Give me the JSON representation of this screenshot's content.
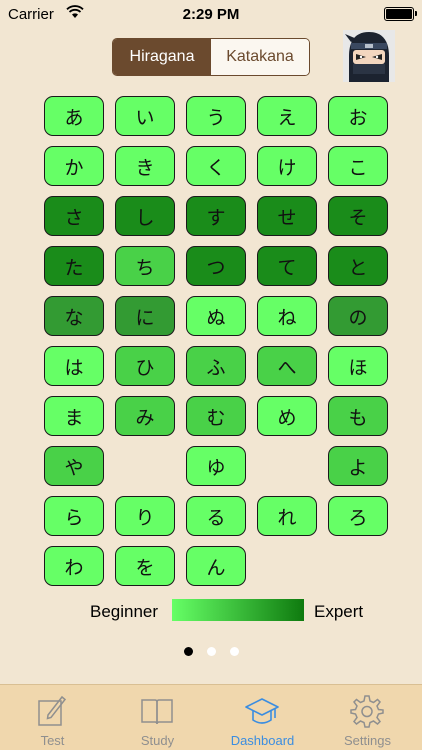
{
  "status_bar": {
    "carrier": "Carrier",
    "time": "2:29 PM"
  },
  "segmented": {
    "options": [
      "Hiragana",
      "Katakana"
    ],
    "selected": "Hiragana"
  },
  "kana_grid": [
    [
      {
        "char": "あ",
        "level": 1
      },
      {
        "char": "い",
        "level": 1
      },
      {
        "char": "う",
        "level": 1
      },
      {
        "char": "え",
        "level": 1
      },
      {
        "char": "お",
        "level": 1
      }
    ],
    [
      {
        "char": "か",
        "level": 1
      },
      {
        "char": "き",
        "level": 1
      },
      {
        "char": "く",
        "level": 1
      },
      {
        "char": "け",
        "level": 1
      },
      {
        "char": "こ",
        "level": 1
      }
    ],
    [
      {
        "char": "さ",
        "level": 4
      },
      {
        "char": "し",
        "level": 4
      },
      {
        "char": "す",
        "level": 4
      },
      {
        "char": "せ",
        "level": 4
      },
      {
        "char": "そ",
        "level": 4
      }
    ],
    [
      {
        "char": "た",
        "level": 4
      },
      {
        "char": "ち",
        "level": 2
      },
      {
        "char": "つ",
        "level": 4
      },
      {
        "char": "て",
        "level": 4
      },
      {
        "char": "と",
        "level": 4
      }
    ],
    [
      {
        "char": "な",
        "level": 3
      },
      {
        "char": "に",
        "level": 3
      },
      {
        "char": "ぬ",
        "level": 1
      },
      {
        "char": "ね",
        "level": 1
      },
      {
        "char": "の",
        "level": 3
      }
    ],
    [
      {
        "char": "は",
        "level": 1
      },
      {
        "char": "ひ",
        "level": 2
      },
      {
        "char": "ふ",
        "level": 2
      },
      {
        "char": "へ",
        "level": 2
      },
      {
        "char": "ほ",
        "level": 1
      }
    ],
    [
      {
        "char": "ま",
        "level": 1
      },
      {
        "char": "み",
        "level": 2
      },
      {
        "char": "む",
        "level": 2
      },
      {
        "char": "め",
        "level": 1
      },
      {
        "char": "も",
        "level": 2
      }
    ],
    [
      {
        "char": "や",
        "level": 2
      },
      null,
      {
        "char": "ゆ",
        "level": 1
      },
      null,
      {
        "char": "よ",
        "level": 2
      }
    ],
    [
      {
        "char": "ら",
        "level": 1
      },
      {
        "char": "り",
        "level": 1
      },
      {
        "char": "る",
        "level": 1
      },
      {
        "char": "れ",
        "level": 1
      },
      {
        "char": "ろ",
        "level": 1
      }
    ],
    [
      {
        "char": "わ",
        "level": 1
      },
      {
        "char": "を",
        "level": 1
      },
      {
        "char": "ん",
        "level": 1
      },
      null,
      null
    ]
  ],
  "level_colors": {
    "1": "#66ff66",
    "2": "#49d148",
    "3": "#339b33",
    "4": "#1a8c1a"
  },
  "legend": {
    "beginner": "Beginner",
    "expert": "Expert",
    "gradient_start": "#66ff66",
    "gradient_end": "#0f7a0f"
  },
  "page_indicator": {
    "pages": 3,
    "current": 1,
    "active_color": "#000000",
    "inactive_color": "#ffffff"
  },
  "tab_bar": {
    "active_color": "#3b8de0",
    "inactive_color": "#8f8f8f",
    "tabs": [
      {
        "label": "Test",
        "icon": "pencil-paper-icon",
        "active": false
      },
      {
        "label": "Study",
        "icon": "open-book-icon",
        "active": false
      },
      {
        "label": "Dashboard",
        "icon": "graduation-cap-icon",
        "active": true
      },
      {
        "label": "Settings",
        "icon": "gear-icon",
        "active": false
      }
    ]
  }
}
